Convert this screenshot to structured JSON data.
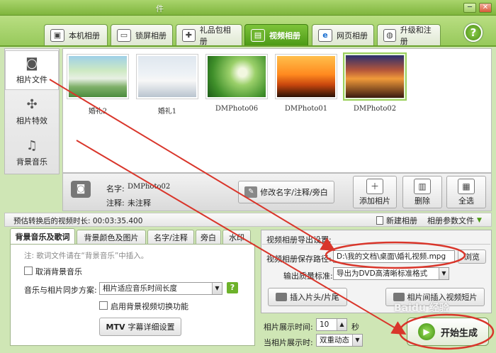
{
  "window": {
    "title": "件",
    "minimize": "─",
    "close": "✕"
  },
  "tabs": [
    {
      "label": "本机相册",
      "icon": "album-icon",
      "glyph": "▣"
    },
    {
      "label": "锁屏相册",
      "icon": "monitor-icon",
      "glyph": "▭"
    },
    {
      "label": "礼品包相册",
      "icon": "gift-icon",
      "glyph": "✚"
    },
    {
      "label": "视频相册",
      "icon": "film-icon",
      "glyph": "▤",
      "active": true
    },
    {
      "label": "网页相册",
      "icon": "ie-icon",
      "glyph": "e"
    },
    {
      "label": "升级和注册",
      "icon": "globe-icon",
      "glyph": "◍"
    }
  ],
  "help": "?",
  "sidebar": {
    "items": [
      {
        "label": "相片文件",
        "icon": "camera-icon",
        "glyph": "◙",
        "active": true
      },
      {
        "label": "相片特效",
        "icon": "effects-icon",
        "glyph": "✣"
      },
      {
        "label": "背景音乐",
        "icon": "music-icon",
        "glyph": "♫"
      }
    ]
  },
  "photos": [
    {
      "caption": "婚礼2"
    },
    {
      "caption": "婚礼1"
    },
    {
      "caption": "DMPhoto06"
    },
    {
      "caption": "DMPhoto01"
    },
    {
      "caption": "DMPhoto02",
      "selected": true
    }
  ],
  "info": {
    "name_label": "名字:",
    "name_value": "DMPhoto02",
    "note_label": "注释:",
    "note_value": "未注释",
    "edit_button": "修改名字/注释/旁白",
    "add_button": "添加相片",
    "delete_button": "删除",
    "select_all_button": "全选"
  },
  "status": {
    "estimate": "预估转换后的视频时长: 00:03:35.400",
    "new_album": "新建相册",
    "album_params": "相册参数文件"
  },
  "left_panel": {
    "tabs": [
      "背景音乐及歌词",
      "背景颜色及图片",
      "名字/注释",
      "旁白",
      "水印"
    ],
    "note": "注: 歌词文件请在“背景音乐”中插入。",
    "cancel_music": "取消背景音乐",
    "sync_label": "音乐与相片同步方案:",
    "sync_value": "相片适应音乐时间长度",
    "sync_help": "?",
    "bg_video_switch": "启用背景视频切换功能",
    "mtv_button": "字幕详细设置",
    "mtv_tag": "MTV"
  },
  "right_panel": {
    "header": "视频相册导出设置:",
    "save_path_label": "视频相册保存路径:",
    "save_path_value": "D:\\我的文档\\桌面\\婚礼视频.mpg",
    "browse_button": "浏览",
    "quality_label": "输出质量标准:",
    "quality_value": "导出为DVD高清晰标准格式",
    "insert_clip_button": "插入片头/片尾",
    "insert_between_button": "相片间插入视频短片"
  },
  "bottom": {
    "display_time_label": "相片展示时间:",
    "display_time_value": "10",
    "display_time_unit": "秒",
    "transition_label": "当相片展示时:",
    "transition_value": "双重动态",
    "start_button": "开始生成",
    "watermark": "Baidu 经验"
  },
  "colors": {
    "title_green": "#7fb53d",
    "active_tab": "#4d9a16",
    "arrow_red": "#d9362b"
  }
}
